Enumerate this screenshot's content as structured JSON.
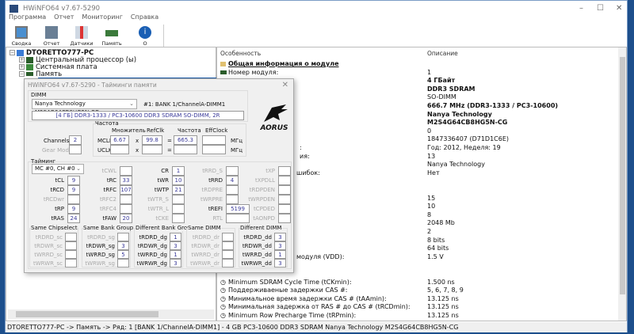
{
  "window": {
    "title": "HWiNFO64 v7.67-5290",
    "controls": [
      "–",
      "☐",
      "✕"
    ]
  },
  "menu": [
    "Программа",
    "Отчет",
    "Мониторинг",
    "Справка"
  ],
  "toolbar": [
    {
      "label": "Сводка",
      "icon": "monitor-icon"
    },
    {
      "label": "Отчет",
      "icon": "save-icon"
    },
    {
      "label": "Датчики",
      "icon": "thermometer-icon"
    },
    {
      "label": "Память",
      "icon": "memory-icon"
    },
    {
      "label": "О программе",
      "icon": "info-icon"
    }
  ],
  "tree": {
    "root": "DTORETTO777-PC",
    "items": [
      "Центральный процессор (ы)",
      "Системная плата",
      "Память"
    ]
  },
  "details": {
    "col_feature": "Особенность",
    "col_desc": "Описание",
    "rows": [
      {
        "label": "Общая информация о модуле",
        "value": "",
        "section": true
      },
      {
        "label": "Номер модуля:",
        "value": "1"
      },
      {
        "label": "",
        "value": "4 ГБайт",
        "bold": true
      },
      {
        "label": "",
        "value": "DDR3 SDRAM",
        "bold": true
      },
      {
        "label": "",
        "value": "SO-DIMM"
      },
      {
        "label": "",
        "value": "666.7 MHz (DDR3-1333 / PC3-10600)",
        "bold": true
      },
      {
        "label": "",
        "value": "Nanya Technology",
        "bold": true
      },
      {
        "label": "",
        "value": "M2S4G64CB8HG5N-CG",
        "bold": true
      },
      {
        "label": "",
        "value": "0"
      },
      {
        "label": "",
        "value": "1847336407 (D71D1C6E)"
      },
      {
        "label": "",
        "tail": ":",
        "value": "Год: 2012, Неделя: 19"
      },
      {
        "label": "",
        "tail": "ия:",
        "value": "13"
      },
      {
        "label": "",
        "value": "Nanya Technology"
      },
      {
        "label": "",
        "tail": "шибок:",
        "value": "Нет"
      },
      {
        "label": "",
        "value": ""
      },
      {
        "label": "",
        "value": ""
      },
      {
        "label": "",
        "value": "15"
      },
      {
        "label": "",
        "value": "10"
      },
      {
        "label": "",
        "value": "8"
      },
      {
        "label": "",
        "value": "2048 Mb"
      },
      {
        "label": "",
        "value": "2"
      },
      {
        "label": "",
        "value": "8 bits"
      },
      {
        "label": "",
        "value": "64 bits"
      },
      {
        "label": "",
        "tail": "модуля (VDD):",
        "value": "1.5 V"
      },
      {
        "label": "",
        "value": ""
      },
      {
        "label": "",
        "value": ""
      },
      {
        "label": "Minimum SDRAM Cycle Time (tCKmin):",
        "value": "1.500 ns",
        "timer": true
      },
      {
        "label": "Поддерживаеные задержки CAS #:",
        "value": "5, 6, 7, 8, 9",
        "timer": true
      },
      {
        "label": "Минимальное время задержки CAS # (tAAmin):",
        "value": "13.125 ns",
        "timer": true
      },
      {
        "label": "Минимальная задержка от RAS # до CAS # (tRCDmin):",
        "value": "13.125 ns",
        "timer": true
      },
      {
        "label": "Minimum Row Precharge Time (tRPmin):",
        "value": "13.125 ns",
        "timer": true
      }
    ]
  },
  "status": "DTORETTO777-PC -> Память -> Ряд: 1 [BANK 1/ChannelA-DIMM1] - 4 GB PC3-10600 DDR3 SDRAM Nanya Technology M2S4G64CB8HG5N-CG",
  "dialog": {
    "title": "HWiNFO64 v7.67-5290 - Тайминги памяти",
    "dimm_label": "DIMM",
    "dimm_select": "Nanya Technology M2S4G64CB8HG5N-CG",
    "slot": "#1: BANK 1/ChannelA-DIMM1",
    "spec": "[4 ГБ] DDR3-1333 / PC3-10600 DDR3 SDRAM SO-DIMM, 2R",
    "logo": "AORUS",
    "freq": {
      "group": "Частота",
      "h_mult": "Множитель",
      "h_ref": "RefClk",
      "h_freq": "Частота",
      "h_eff": "EffClock",
      "mclk": "MCLK",
      "uclk": "UCLK",
      "mclk_mult": "6.67",
      "mclk_ref": "99.8",
      "mclk_freq": "665.3",
      "x": "x",
      "eq": "=",
      "unit": "МГц"
    },
    "channels_label": "Channels",
    "channels": "2",
    "gear_label": "Gear Mode",
    "timing_label": "Тайминг",
    "mc_select": "MC #0, CH #0",
    "timings": [
      [
        {
          "n": "tCL",
          "v": "9"
        },
        {
          "n": "tRCD",
          "v": "9"
        },
        {
          "n": "tRCDwr",
          "v": ""
        },
        {
          "n": "tRP",
          "v": "9"
        },
        {
          "n": "tRAS",
          "v": "24"
        }
      ],
      [
        {
          "n": "tCWL",
          "v": ""
        },
        {
          "n": "tRC",
          "v": "33"
        },
        {
          "n": "tRFC",
          "v": "107"
        },
        {
          "n": "tRFC2",
          "v": ""
        },
        {
          "n": "tRFC4",
          "v": ""
        },
        {
          "n": "tFAW",
          "v": "20"
        }
      ],
      [
        {
          "n": "CR",
          "v": "1"
        },
        {
          "n": "tWR",
          "v": "10"
        },
        {
          "n": "tWTP",
          "v": "21"
        },
        {
          "n": "tWTR_S",
          "v": ""
        },
        {
          "n": "tWTR_L",
          "v": ""
        },
        {
          "n": "tCKE",
          "v": ""
        }
      ],
      [
        {
          "n": "tRRD_S",
          "v": ""
        },
        {
          "n": "tRRD",
          "v": "4"
        },
        {
          "n": "tRDPRE",
          "v": ""
        },
        {
          "n": "tWRPRE",
          "v": ""
        },
        {
          "n": "tREFI",
          "v": "5199"
        },
        {
          "n": "RTL",
          "v": ""
        }
      ],
      [
        {
          "n": "tXP",
          "v": ""
        },
        {
          "n": "tXPDLL",
          "v": ""
        },
        {
          "n": "tRDPDEN",
          "v": ""
        },
        {
          "n": "tWRPDEN",
          "v": ""
        },
        {
          "n": "tCPDED",
          "v": ""
        },
        {
          "n": "tAONPD",
          "v": ""
        }
      ]
    ],
    "groups": [
      {
        "title": "Same Chipselect",
        "items": [
          {
            "n": "tRDRD_sc",
            "v": ""
          },
          {
            "n": "tRDWR_sc",
            "v": ""
          },
          {
            "n": "tWRRD_sc",
            "v": ""
          },
          {
            "n": "tWRWR_sc",
            "v": ""
          }
        ]
      },
      {
        "title": "Same Bank Group",
        "items": [
          {
            "n": "tRDRD_sg",
            "v": ""
          },
          {
            "n": "tRDWR_sg",
            "v": "3"
          },
          {
            "n": "tWRRD_sg",
            "v": "5"
          },
          {
            "n": "tWRWR_sg",
            "v": ""
          }
        ]
      },
      {
        "title": "Different Bank Group",
        "items": [
          {
            "n": "tRDRD_dg",
            "v": "1"
          },
          {
            "n": "tRDWR_dg",
            "v": "3"
          },
          {
            "n": "tWRRD_dg",
            "v": "1"
          },
          {
            "n": "tWRWR_dg",
            "v": "3"
          }
        ]
      },
      {
        "title": "Same DIMM",
        "items": [
          {
            "n": "tRDRD_dr",
            "v": ""
          },
          {
            "n": "tRDWR_dr",
            "v": ""
          },
          {
            "n": "tWRRD_dr",
            "v": ""
          },
          {
            "n": "tWRWR_dr",
            "v": ""
          }
        ]
      },
      {
        "title": "Different DIMM",
        "items": [
          {
            "n": "tRDRD_dd",
            "v": "3"
          },
          {
            "n": "tRDWR_dd",
            "v": "3"
          },
          {
            "n": "tWRRD_dd",
            "v": "1"
          },
          {
            "n": "tWRWR_dd",
            "v": "3"
          }
        ]
      }
    ]
  }
}
